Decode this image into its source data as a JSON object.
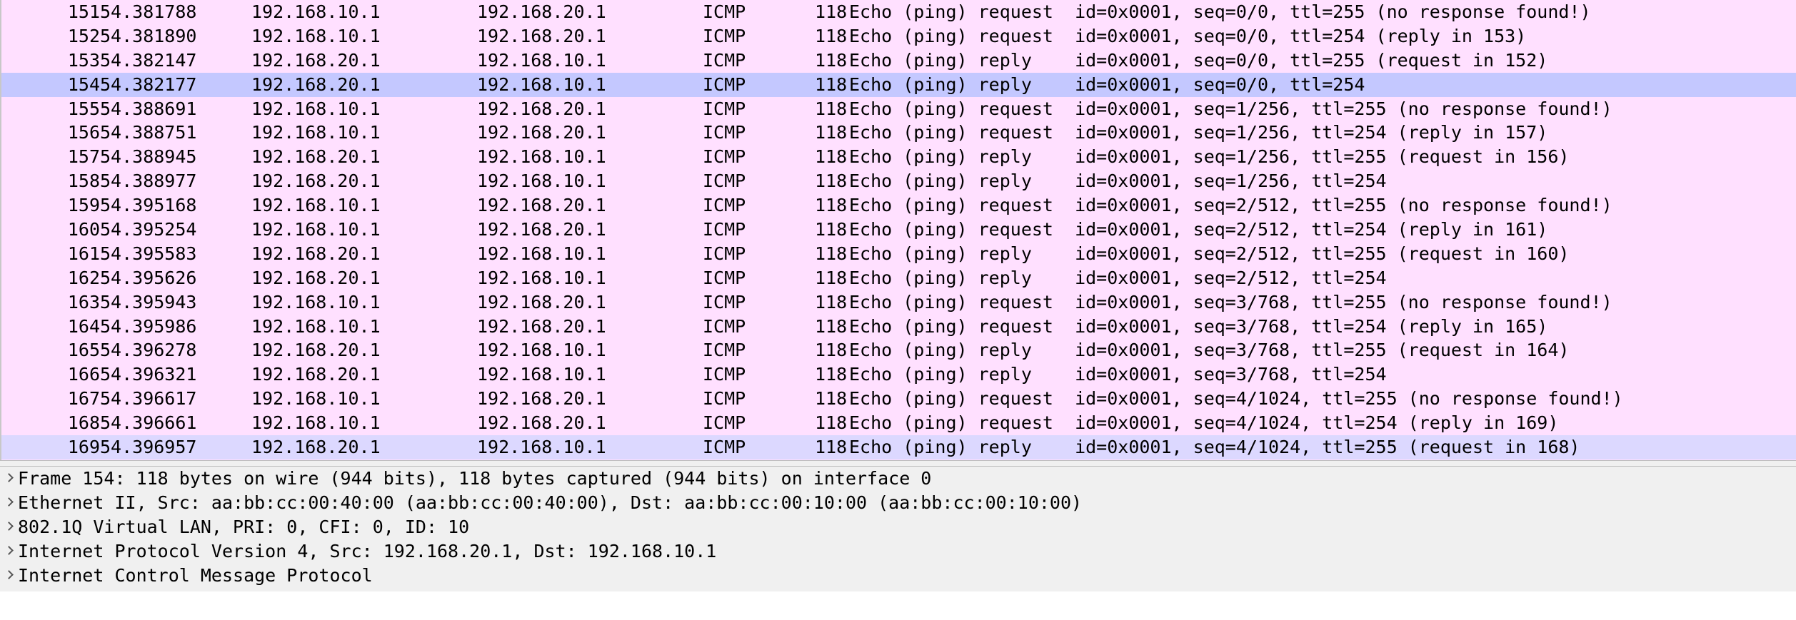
{
  "packet_list": {
    "rows": [
      {
        "no": "151",
        "time": "54.381788",
        "source": "192.168.10.1",
        "destination": "192.168.20.1",
        "protocol": "ICMP",
        "length": "118",
        "info": "Echo (ping) request  id=0x0001, seq=0/0, ttl=255 (no response found!)"
      },
      {
        "no": "152",
        "time": "54.381890",
        "source": "192.168.10.1",
        "destination": "192.168.20.1",
        "protocol": "ICMP",
        "length": "118",
        "info": "Echo (ping) request  id=0x0001, seq=0/0, ttl=254 (reply in 153)"
      },
      {
        "no": "153",
        "time": "54.382147",
        "source": "192.168.20.1",
        "destination": "192.168.10.1",
        "protocol": "ICMP",
        "length": "118",
        "info": "Echo (ping) reply    id=0x0001, seq=0/0, ttl=255 (request in 152)"
      },
      {
        "no": "154",
        "time": "54.382177",
        "source": "192.168.20.1",
        "destination": "192.168.10.1",
        "protocol": "ICMP",
        "length": "118",
        "info": "Echo (ping) reply    id=0x0001, seq=0/0, ttl=254"
      },
      {
        "no": "155",
        "time": "54.388691",
        "source": "192.168.10.1",
        "destination": "192.168.20.1",
        "protocol": "ICMP",
        "length": "118",
        "info": "Echo (ping) request  id=0x0001, seq=1/256, ttl=255 (no response found!)"
      },
      {
        "no": "156",
        "time": "54.388751",
        "source": "192.168.10.1",
        "destination": "192.168.20.1",
        "protocol": "ICMP",
        "length": "118",
        "info": "Echo (ping) request  id=0x0001, seq=1/256, ttl=254 (reply in 157)"
      },
      {
        "no": "157",
        "time": "54.388945",
        "source": "192.168.20.1",
        "destination": "192.168.10.1",
        "protocol": "ICMP",
        "length": "118",
        "info": "Echo (ping) reply    id=0x0001, seq=1/256, ttl=255 (request in 156)"
      },
      {
        "no": "158",
        "time": "54.388977",
        "source": "192.168.20.1",
        "destination": "192.168.10.1",
        "protocol": "ICMP",
        "length": "118",
        "info": "Echo (ping) reply    id=0x0001, seq=1/256, ttl=254"
      },
      {
        "no": "159",
        "time": "54.395168",
        "source": "192.168.10.1",
        "destination": "192.168.20.1",
        "protocol": "ICMP",
        "length": "118",
        "info": "Echo (ping) request  id=0x0001, seq=2/512, ttl=255 (no response found!)"
      },
      {
        "no": "160",
        "time": "54.395254",
        "source": "192.168.10.1",
        "destination": "192.168.20.1",
        "protocol": "ICMP",
        "length": "118",
        "info": "Echo (ping) request  id=0x0001, seq=2/512, ttl=254 (reply in 161)"
      },
      {
        "no": "161",
        "time": "54.395583",
        "source": "192.168.20.1",
        "destination": "192.168.10.1",
        "protocol": "ICMP",
        "length": "118",
        "info": "Echo (ping) reply    id=0x0001, seq=2/512, ttl=255 (request in 160)"
      },
      {
        "no": "162",
        "time": "54.395626",
        "source": "192.168.20.1",
        "destination": "192.168.10.1",
        "protocol": "ICMP",
        "length": "118",
        "info": "Echo (ping) reply    id=0x0001, seq=2/512, ttl=254"
      },
      {
        "no": "163",
        "time": "54.395943",
        "source": "192.168.10.1",
        "destination": "192.168.20.1",
        "protocol": "ICMP",
        "length": "118",
        "info": "Echo (ping) request  id=0x0001, seq=3/768, ttl=255 (no response found!)"
      },
      {
        "no": "164",
        "time": "54.395986",
        "source": "192.168.10.1",
        "destination": "192.168.20.1",
        "protocol": "ICMP",
        "length": "118",
        "info": "Echo (ping) request  id=0x0001, seq=3/768, ttl=254 (reply in 165)"
      },
      {
        "no": "165",
        "time": "54.396278",
        "source": "192.168.20.1",
        "destination": "192.168.10.1",
        "protocol": "ICMP",
        "length": "118",
        "info": "Echo (ping) reply    id=0x0001, seq=3/768, ttl=255 (request in 164)"
      },
      {
        "no": "166",
        "time": "54.396321",
        "source": "192.168.20.1",
        "destination": "192.168.10.1",
        "protocol": "ICMP",
        "length": "118",
        "info": "Echo (ping) reply    id=0x0001, seq=3/768, ttl=254"
      },
      {
        "no": "167",
        "time": "54.396617",
        "source": "192.168.10.1",
        "destination": "192.168.20.1",
        "protocol": "ICMP",
        "length": "118",
        "info": "Echo (ping) request  id=0x0001, seq=4/1024, ttl=255 (no response found!)"
      },
      {
        "no": "168",
        "time": "54.396661",
        "source": "192.168.10.1",
        "destination": "192.168.20.1",
        "protocol": "ICMP",
        "length": "118",
        "info": "Echo (ping) request  id=0x0001, seq=4/1024, ttl=254 (reply in 169)"
      },
      {
        "no": "169",
        "time": "54.396957",
        "source": "192.168.20.1",
        "destination": "192.168.10.1",
        "protocol": "ICMP",
        "length": "118",
        "info": "Echo (ping) reply    id=0x0001, seq=4/1024, ttl=255 (request in 168)"
      }
    ]
  },
  "details": {
    "items": [
      {
        "text": "Frame 154: 118 bytes on wire (944 bits), 118 bytes captured (944 bits) on interface 0",
        "icon": "chevron-right-icon"
      },
      {
        "text": "Ethernet II, Src: aa:bb:cc:00:40:00 (aa:bb:cc:00:40:00), Dst: aa:bb:cc:00:10:00 (aa:bb:cc:00:10:00)",
        "icon": "chevron-right-icon"
      },
      {
        "text": "802.1Q Virtual LAN, PRI: 0, CFI: 0, ID: 10",
        "icon": "chevron-right-icon"
      },
      {
        "text": "Internet Protocol Version 4, Src: 192.168.20.1, Dst: 192.168.10.1",
        "icon": "chevron-right-icon"
      },
      {
        "text": "Internet Control Message Protocol",
        "icon": "chevron-right-icon"
      }
    ]
  },
  "colors": {
    "icmp_row_bg": "#ffe0ff",
    "selected_row_bg": "#c4c8ff",
    "details_bg": "#f0f0f0"
  }
}
